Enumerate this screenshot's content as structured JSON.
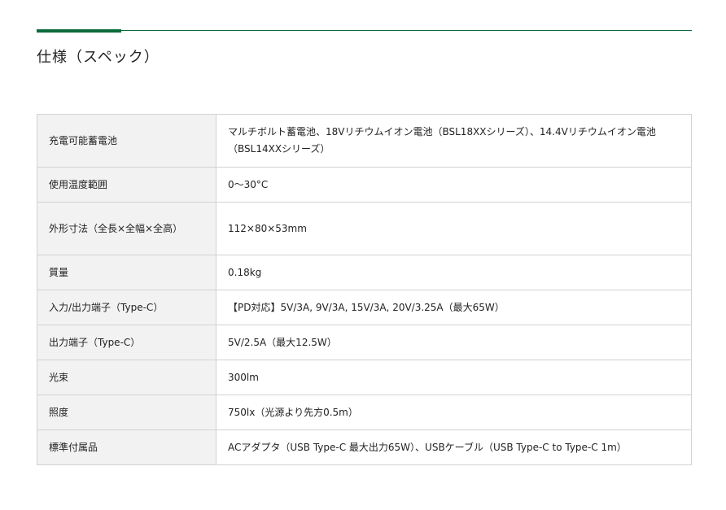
{
  "section": {
    "title": "仕様（スペック）"
  },
  "specs": [
    {
      "label": "充電可能蓄電池",
      "value": "マルチボルト蓄電池、18Vリチウムイオン電池（BSL18XXシリーズ）、14.4Vリチウムイオン電池（BSL14XXシリーズ）"
    },
    {
      "label": "使用温度範囲",
      "value": "0〜30°C"
    },
    {
      "label": "外形寸法（全長×全幅×全高）",
      "value": "112×80×53mm"
    },
    {
      "label": "質量",
      "value": "0.18kg"
    },
    {
      "label": "入力/出力端子（Type-C）",
      "value": "【PD対応】5V/3A, 9V/3A, 15V/3A, 20V/3.25A（最大65W）"
    },
    {
      "label": "出力端子（Type-C）",
      "value": "5V/2.5A（最大12.5W）"
    },
    {
      "label": "光束",
      "value": "300lm"
    },
    {
      "label": "照度",
      "value": "750lx（光源より先方0.5m）"
    },
    {
      "label": "標準付属品",
      "value": "ACアダプタ（USB Type-C 最大出力65W）、USBケーブル（USB Type-C to Type-C 1m）"
    }
  ],
  "colors": {
    "accent": "#0b6b3a",
    "label_background": "#f2f2f2",
    "border": "#d2d2d2"
  }
}
